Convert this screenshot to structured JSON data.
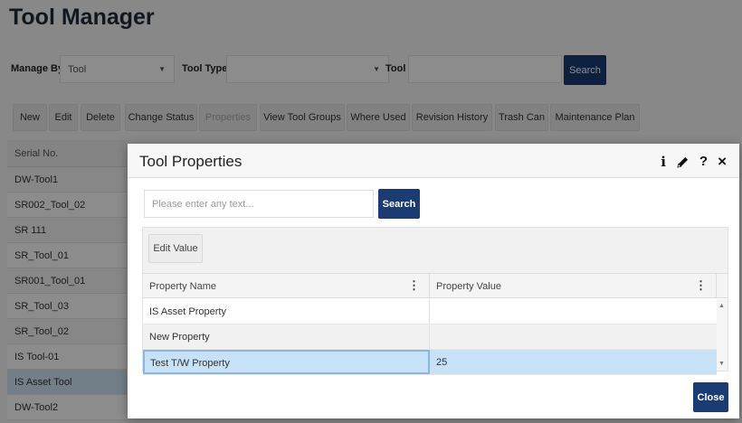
{
  "page": {
    "title": "Tool Manager"
  },
  "filters": {
    "manage_by_label": "Manage By",
    "manage_by_value": "Tool",
    "tool_type_label": "Tool Type",
    "tool_type_value": "",
    "tool_label": "Tool",
    "tool_value": "",
    "search_label": "Search"
  },
  "toolbar": {
    "buttons": [
      "New",
      "Edit",
      "Delete",
      "Change Status",
      "Properties",
      "View Tool Groups",
      "Where Used",
      "Revision History",
      "Trash Can",
      "Maintenance Plan"
    ]
  },
  "grid": {
    "header": "Serial No.",
    "rows": [
      "DW-Tool1",
      "SR002_Tool_02",
      "SR 111",
      "SR_Tool_01",
      "SR001_Tool_01",
      "SR_Tool_03",
      "SR_Tool_02",
      "IS Tool-01",
      "IS Asset Tool",
      "DW-Tool2"
    ]
  },
  "modal": {
    "title": "Tool Properties",
    "icons": [
      "info-icon",
      "pencil-icon",
      "help-icon",
      "close-icon"
    ],
    "info_glyph": "i",
    "help_glyph": "?",
    "close_glyph": "×",
    "search_placeholder": "Please enter any text...",
    "search_button": "Search",
    "edit_value_button": "Edit Value",
    "columns": [
      "Property Name",
      "Property Value"
    ],
    "rows": [
      {
        "name": "IS Asset Property",
        "value": ""
      },
      {
        "name": "New Property",
        "value": ""
      },
      {
        "name": "Test T/W Property",
        "value": "25"
      }
    ],
    "close_button": "Close"
  },
  "colors": {
    "primary": "#1b3b73",
    "selected_row": "#c7e2f6"
  }
}
